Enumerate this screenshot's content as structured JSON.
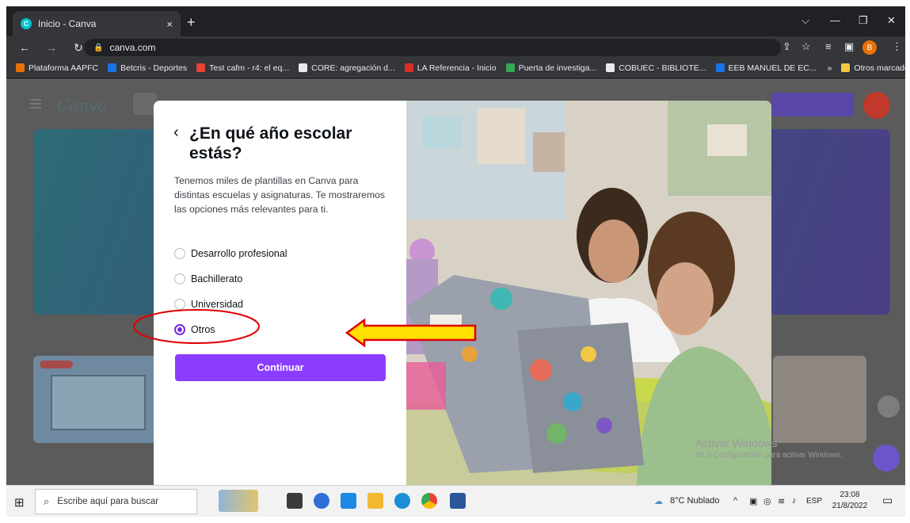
{
  "browser": {
    "tab_title": "Inicio - Canva",
    "tab_close": "×",
    "new_tab": "+",
    "url": "canva.com",
    "profile_initial": "B",
    "window_controls": {
      "minimize": "—",
      "restore": "❐",
      "close": "✕",
      "tabs_menu": "⌵"
    },
    "bookmarks": [
      {
        "label": "Plataforma AAPFC",
        "color": "#e8710a"
      },
      {
        "label": "Betcris - Deportes",
        "color": "#1a73e8"
      },
      {
        "label": "Test cafm - r4: el eq...",
        "color": "#ea4335"
      },
      {
        "label": "CORE: agregación d...",
        "color": "#e8eaed"
      },
      {
        "label": "LA Referencia - Inicio",
        "color": "#d93025"
      },
      {
        "label": "Puerta de investiga...",
        "color": "#34a853"
      },
      {
        "label": "COBUEC - BIBLIOTE...",
        "color": "#e8eaed"
      },
      {
        "label": "EEB MANUEL DE EC...",
        "color": "#1a73e8"
      }
    ],
    "bookmarks_overflow": "»",
    "other_bookmarks": "Otros marcadores"
  },
  "modal": {
    "back_glyph": "‹",
    "title": "¿En qué año escolar estás?",
    "description": "Tenemos miles de plantillas en Canva para distintas escuelas y asignaturas. Te mostraremos las opciones más relevantes para ti.",
    "options": [
      "Desarrollo profesional",
      "Bachillerato",
      "Universidad",
      "Otros"
    ],
    "selected_option": "Otros",
    "continue_label": "Continuar",
    "accent_color": "#8b3dff"
  },
  "watermark": {
    "line1": "Activar Windows",
    "line2": "Ve a Configuración para activar Windows."
  },
  "taskbar": {
    "search_placeholder": "Escribe aquí para buscar",
    "weather": "8°C  Nublado",
    "language": "ESP",
    "time": "23:08",
    "date": "21/8/2022"
  }
}
